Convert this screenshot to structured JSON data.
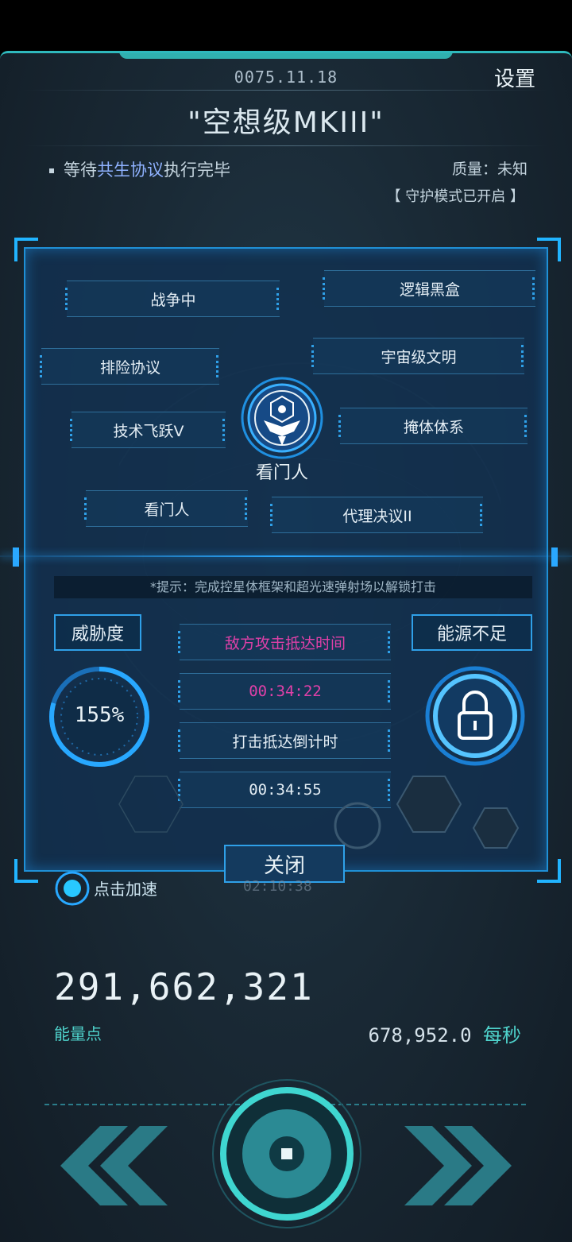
{
  "header": {
    "date": "0075.11.18",
    "settings_label": "设置",
    "ship_title": "\"空想级MKIII\"",
    "status_prefix": "等待",
    "status_highlight": "共生协议",
    "status_suffix": "执行完毕",
    "quality": "质量：未知",
    "guard_mode": "【 守护模式已开启 】"
  },
  "tech_tree": {
    "items": [
      "战争中",
      "逻辑黑盒",
      "排险协议",
      "宇宙级文明",
      "技术飞跃V",
      "掩体体系",
      "看门人",
      "代理决议II"
    ],
    "center_label": "看门人"
  },
  "attack_panel": {
    "tip": "*提示：完成控星体框架和超光速弹射场以解锁打击",
    "threat_label": "威胁度",
    "threat_value": "155%",
    "threat_percent": 155,
    "energy_label": "能源不足",
    "enemy_arrival_label": "敌方攻击抵达时间",
    "enemy_arrival_time": "00:34:22",
    "strike_countdown_label": "打击抵达倒计时",
    "strike_countdown_time": "00:34:55",
    "close_label": "关闭"
  },
  "accelerate": {
    "label": "点击加速",
    "timer": "02:10:38"
  },
  "stats": {
    "energy_points": "291,662,321",
    "energy_label": "能量点",
    "rate_value": "678,952.0",
    "rate_unit": "每秒"
  },
  "colors": {
    "accent": "#2fa0e8",
    "teal": "#4fd3cc",
    "highlight": "#8fb2ff",
    "alert": "#e040a8"
  },
  "icons": [
    "eagle-emblem-icon",
    "padlock-icon",
    "chevron-left-icon",
    "chevron-right-icon",
    "center-button-icon",
    "globe-icon"
  ]
}
